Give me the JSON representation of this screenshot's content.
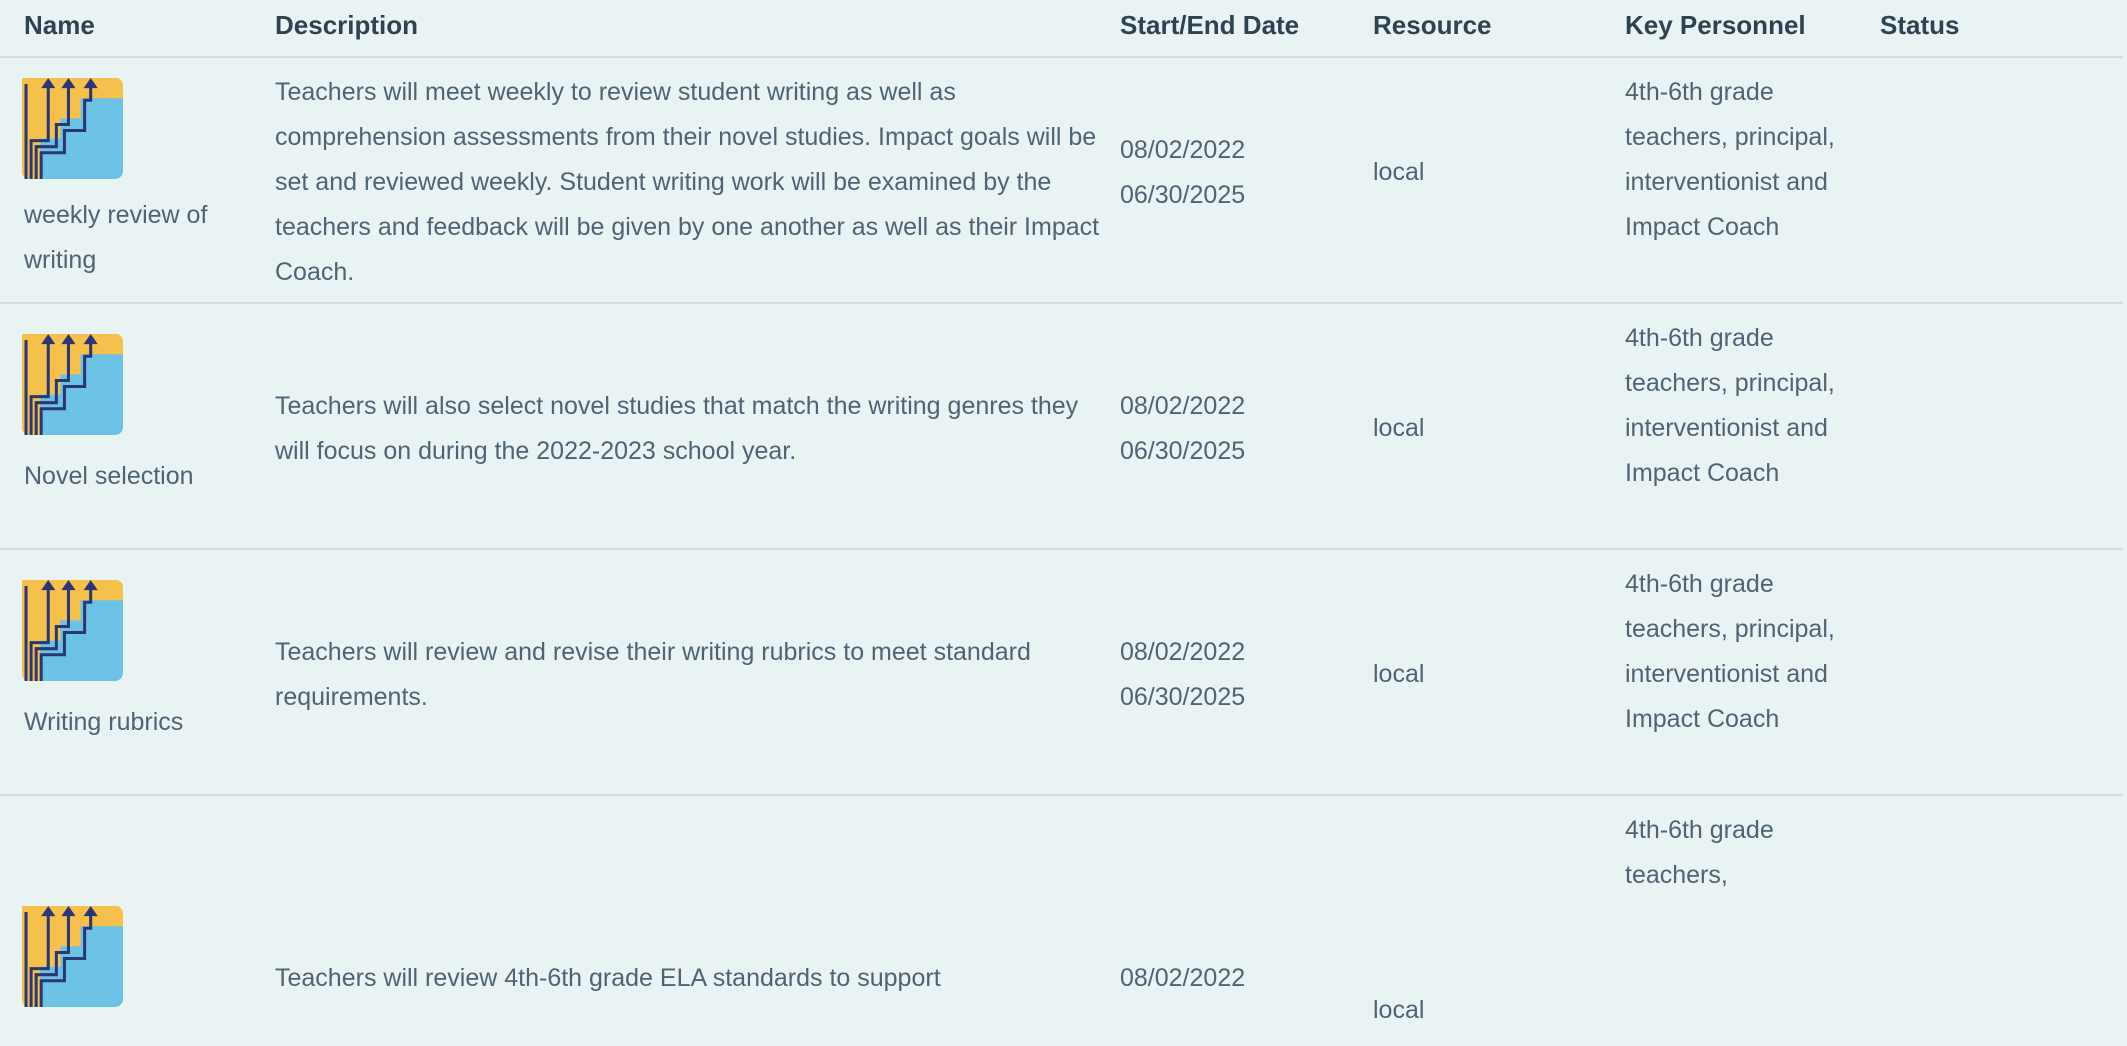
{
  "headers": {
    "name": "Name",
    "description": "Description",
    "dates": "Start/End Date",
    "resource": "Resource",
    "key_personnel": "Key Personnel",
    "status": "Status"
  },
  "icon": "stair-steps-arrows-icon",
  "colors": {
    "background": "#e9f3f4",
    "icon_yellow": "#f5c14c",
    "icon_blue": "#6cc2e5",
    "icon_navy": "#2b3674"
  },
  "rows": [
    {
      "name": "weekly review of writing",
      "description": "Teachers will meet weekly to review student writing as well as comprehension assessments from their novel studies. Impact goals will be set and reviewed weekly. Student writing work will be examined by the teachers and feedback will be given by one another as well as their Impact Coach.",
      "start_date": "08/02/2022",
      "end_date": "06/30/2025",
      "resource": "local",
      "key_personnel": "4th-6th grade teachers, principal, interventionist and Impact Coach",
      "status": ""
    },
    {
      "name": "Novel selection",
      "description": "Teachers will also select novel studies that match the writing genres they will focus on during the 2022-2023 school year.",
      "start_date": "08/02/2022",
      "end_date": "06/30/2025",
      "resource": "local",
      "key_personnel": "4th-6th grade teachers, principal, interventionist and Impact Coach",
      "status": ""
    },
    {
      "name": "Writing rubrics",
      "description": "Teachers will review and revise their writing rubrics to meet standard requirements.",
      "start_date": "08/02/2022",
      "end_date": "06/30/2025",
      "resource": "local",
      "key_personnel": "4th-6th grade teachers, principal, interventionist and Impact Coach",
      "status": ""
    },
    {
      "name": "",
      "description": "Teachers will review 4th-6th grade ELA standards to support",
      "start_date": "08/02/2022",
      "end_date": "",
      "resource": "local",
      "key_personnel": "4th-6th grade teachers,",
      "status": ""
    }
  ]
}
